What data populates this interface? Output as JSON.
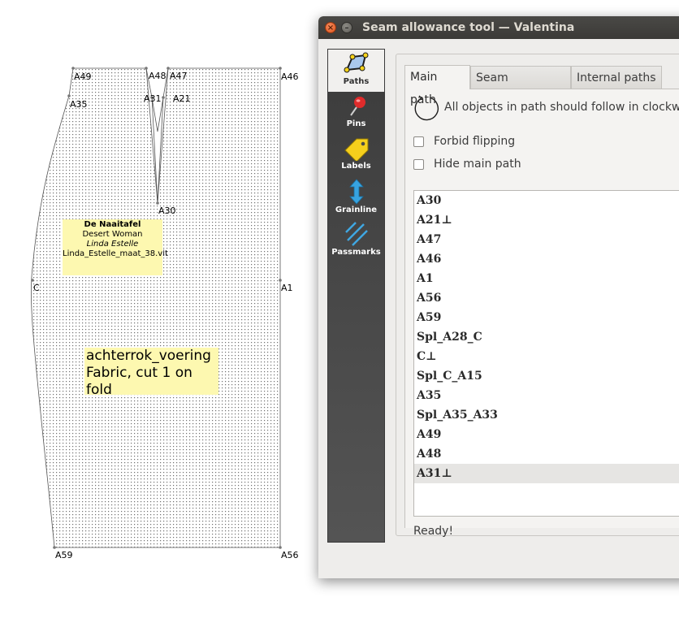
{
  "canvas": {
    "points": {
      "a49": "A49",
      "a48": "A48",
      "a47": "A47",
      "a46": "A46",
      "a35": "A35",
      "a31": "A31",
      "a21": "A21",
      "a30": "A30",
      "c": "C",
      "a1": "A1",
      "a59": "A59",
      "a56": "A56"
    },
    "info_label": {
      "company": "De Naaitafel",
      "pattern_name": "Desert Woman",
      "designer": "Linda Estelle",
      "measurements_file": "Linda_Estelle_maat_38.vit"
    },
    "piece_label": {
      "name": "achterrok_voering",
      "instructions": "Fabric, cut 1 on fold"
    }
  },
  "dialog": {
    "title": "Seam allowance tool — Valentina",
    "close_glyph": "×",
    "minimize_glyph": "–",
    "sidebar": {
      "items": [
        {
          "label": "Paths",
          "icon": "paths-icon"
        },
        {
          "label": "Pins",
          "icon": "pin-icon"
        },
        {
          "label": "Labels",
          "icon": "label-tag-icon"
        },
        {
          "label": "Grainline",
          "icon": "grainline-arrow-icon"
        },
        {
          "label": "Passmarks",
          "icon": "passmarks-icon"
        }
      ]
    },
    "tabs": {
      "main_path": "Main path",
      "seam_allowance": "Seam allowance",
      "internal_paths": "Internal paths"
    },
    "main_path": {
      "direction_hint": "All objects in path should follow in clockwise direction.",
      "forbid_flipping": "Forbid flipping",
      "hide_main_path": "Hide main path",
      "items": [
        "A30",
        "A21⊥",
        "A47",
        "A46",
        "A1",
        "A56",
        "A59",
        "Spl_A28_C",
        "C⊥",
        "Spl_C_A15",
        "A35",
        "Spl_A35_A33",
        "A49",
        "A48",
        "A31⊥"
      ],
      "selected_item": "A31⊥",
      "status": "Ready!"
    }
  }
}
